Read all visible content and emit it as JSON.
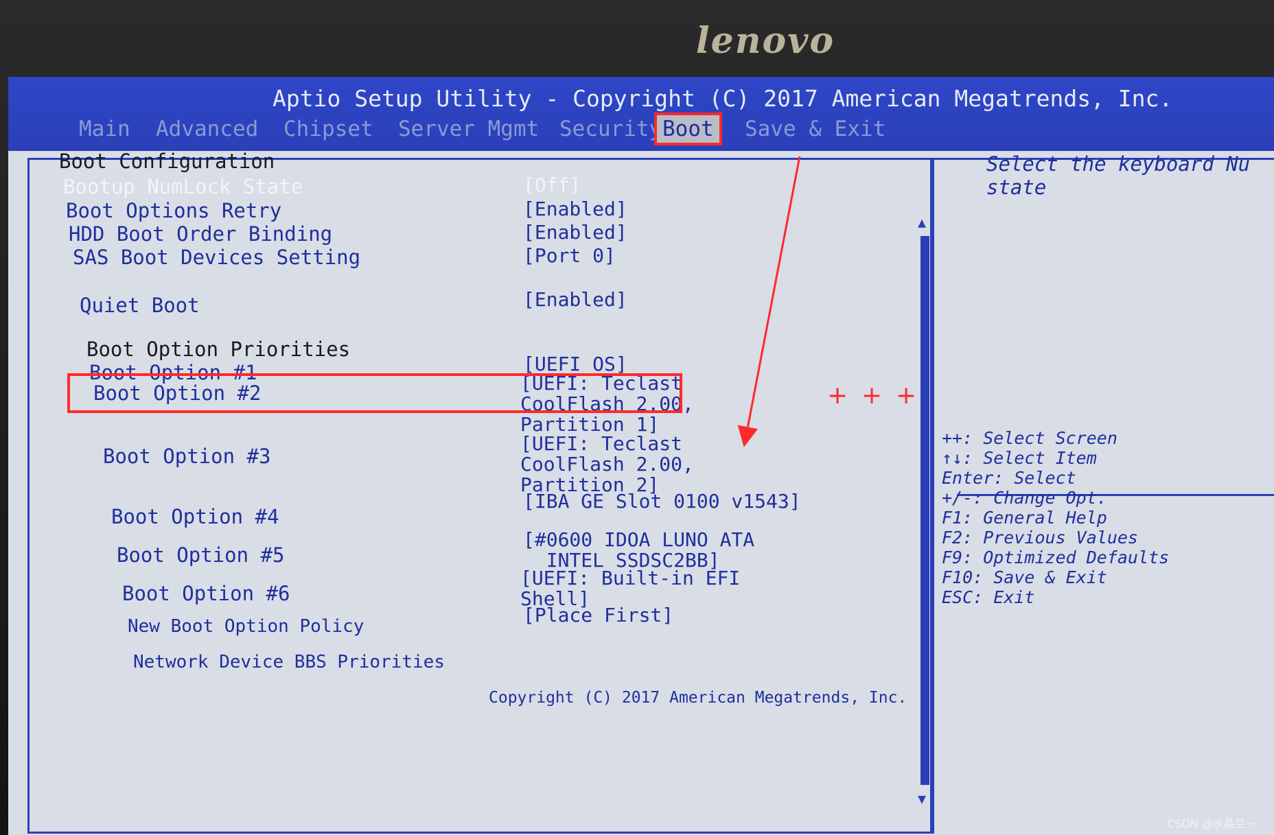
{
  "monitor": {
    "brand": "lenovo"
  },
  "header": {
    "title": "Aptio Setup Utility - Copyright (C) 2017 American Megatrends, Inc.",
    "tabs": [
      {
        "label": "Main"
      },
      {
        "label": "Advanced"
      },
      {
        "label": "Chipset"
      },
      {
        "label": "Server Mgmt"
      },
      {
        "label": "Security"
      },
      {
        "label": "Boot",
        "active": true
      },
      {
        "label": "Save & Exit"
      }
    ]
  },
  "main": {
    "section_title": "Boot Configuration",
    "items": [
      {
        "label": "Bootup NumLock State",
        "value": "[Off]"
      },
      {
        "label": "Boot Options Retry",
        "value": "[Enabled]"
      },
      {
        "label": "HDD Boot Order Binding",
        "value": "[Enabled]"
      },
      {
        "label": "SAS Boot Devices Setting",
        "value": "[Port 0]"
      },
      {
        "label": "Quiet Boot",
        "value": "[Enabled]"
      }
    ],
    "priorities_title": "Boot Option Priorities",
    "boot_options": [
      {
        "label": "Boot Option #1",
        "value": "[UEFI OS]"
      },
      {
        "label": "Boot Option #2",
        "value": "[UEFI: Teclast\nCoolFlash 2.00,\nPartition 1]"
      },
      {
        "label": "Boot Option #3",
        "value": "[UEFI: Teclast\nCoolFlash 2.00,\nPartition 2]"
      },
      {
        "label": "Boot Option #4",
        "value": "[IBA GE Slot 0100 v1543]"
      },
      {
        "label": "Boot Option #5",
        "value": "[#0600 IDOA LUNO ATA\n  INTEL SSDSC2BB]"
      },
      {
        "label": "Boot Option #6",
        "value": "[UEFI: Built-in EFI\nShell]"
      },
      {
        "label": "New Boot Option Policy",
        "value": "[Place First]"
      },
      {
        "label": "Network Device BBS Priorities",
        "value": ""
      }
    ]
  },
  "help": {
    "description": "Select the keyboard Nu\nstate",
    "keys": "++: Select Screen\n↑↓: Select Item\nEnter: Select\n+/-: Change Opt.\nF1: General Help\nF2: Previous Values\nF9: Optimized Defaults\nF10: Save & Exit\nESC: Exit"
  },
  "footer": {
    "text": "Copyright (C) 2017 American Megatrends, Inc."
  },
  "annotation": {
    "plus_marks": [
      "+",
      "+",
      "+"
    ]
  },
  "watermark": {
    "text": "CSDN @水晶兰~"
  }
}
